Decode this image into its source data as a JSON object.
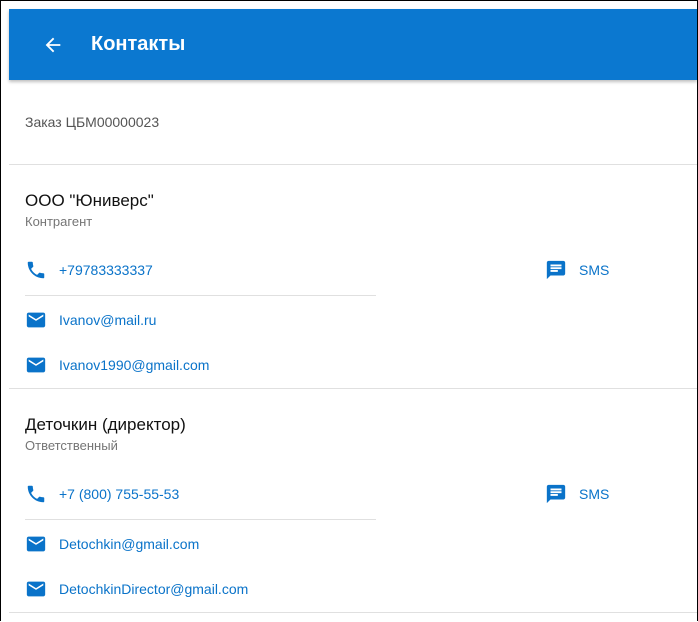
{
  "header": {
    "title": "Контакты"
  },
  "order": {
    "label": "Заказ ЦБМ00000023"
  },
  "contacts": [
    {
      "name": "ООО \"Юниверс\"",
      "role": "Контрагент",
      "phone": "+79783333337",
      "sms_label": "SMS",
      "emails": [
        "Ivanov@mail.ru",
        "Ivanov1990@gmail.com"
      ]
    },
    {
      "name": "Деточкин (директор)",
      "role": "Ответственный",
      "phone": "+7 (800) 755-55-53",
      "sms_label": "SMS",
      "emails": [
        "Detochkin@gmail.com",
        "DetochkinDirector@gmail.com"
      ]
    }
  ],
  "colors": {
    "appbar": "#0b78d0",
    "link": "#0a73c9",
    "divider": "#e0e0e0"
  },
  "icons": {
    "back": "arrow-left-icon",
    "phone": "phone-icon",
    "email": "email-icon",
    "sms": "message-icon"
  }
}
